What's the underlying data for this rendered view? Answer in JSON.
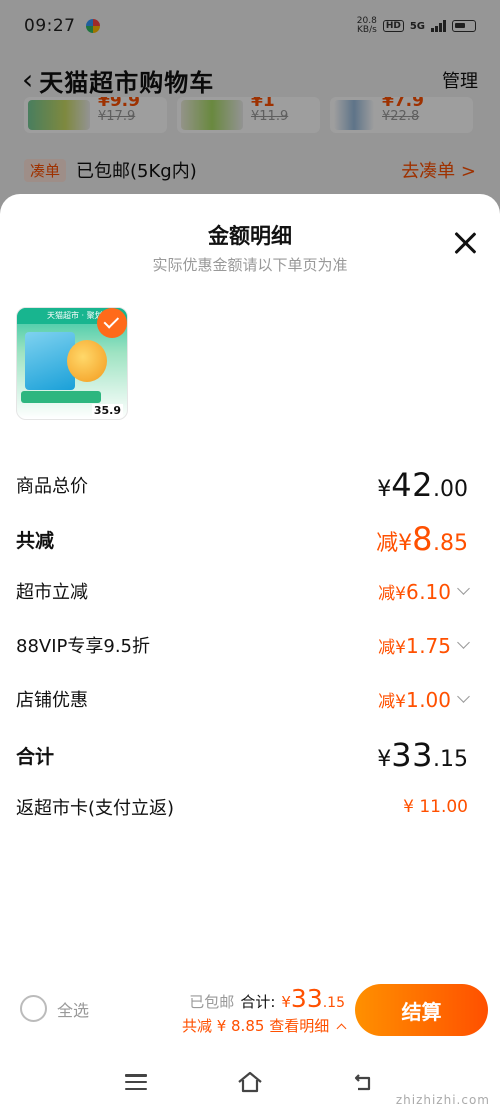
{
  "status_bar": {
    "time": "09:27",
    "net_speed_value": "20.8",
    "net_speed_unit": "KB/s",
    "hd_label": "HD",
    "network": "5G"
  },
  "header": {
    "title": "天猫超市购物车",
    "manage_label": "管理"
  },
  "recommendations": [
    {
      "price": "¥9.9",
      "old_price": "¥17.9"
    },
    {
      "price": "¥1",
      "old_price": "¥11.9"
    },
    {
      "price": "¥7.9",
      "old_price": "¥22.8"
    }
  ],
  "shipping_row": {
    "tag": "凑单",
    "text": "已包邮(5Kg内)",
    "link": "去凑单 >"
  },
  "sheet": {
    "title": "金额明细",
    "subtitle": "实际优惠金额请以下单页为准",
    "product_image": {
      "banner": "天猫超市 · 聚划算",
      "price_tag": "35.9"
    },
    "rows": [
      {
        "label": "商品总价",
        "prefix": "",
        "yen": "¥",
        "int": "42",
        "dec": ".00"
      },
      {
        "label": "共减",
        "prefix": "减",
        "yen": "¥",
        "int": "8",
        "dec": ".85"
      },
      {
        "label": "超市立减",
        "prefix": "减",
        "yen": "¥",
        "int": "6",
        "dec": ".10"
      },
      {
        "label": "88VIP专享9.5折",
        "prefix": "减",
        "yen": "¥",
        "int": "1",
        "dec": ".75"
      },
      {
        "label": "店铺优惠",
        "prefix": "减",
        "yen": "¥",
        "int": "1",
        "dec": ".00"
      },
      {
        "label": "合计",
        "prefix": "",
        "yen": "¥",
        "int": "33",
        "dec": ".15"
      }
    ],
    "cashback": {
      "label": "返超市卡(支付立返)",
      "value": "¥ 11.00"
    }
  },
  "footer": {
    "select_all": "全选",
    "free_shipping": "已包邮",
    "total_label": "合计:",
    "total_yen": "¥",
    "total_int": "33",
    "total_dec": ".15",
    "discount_text": "共减 ¥ 8.85",
    "view_detail": "查看明细",
    "checkout_label": "结算"
  },
  "watermark": "zhizhizhi.com",
  "colors": {
    "accent": "#ff5000",
    "checkout_start": "#ff9000",
    "checkout_end": "#ff5000"
  },
  "icons": [
    "back-arrow-icon",
    "close-icon",
    "check-icon",
    "chevron-down-icon",
    "menu-icon",
    "home-icon",
    "back-icon"
  ]
}
